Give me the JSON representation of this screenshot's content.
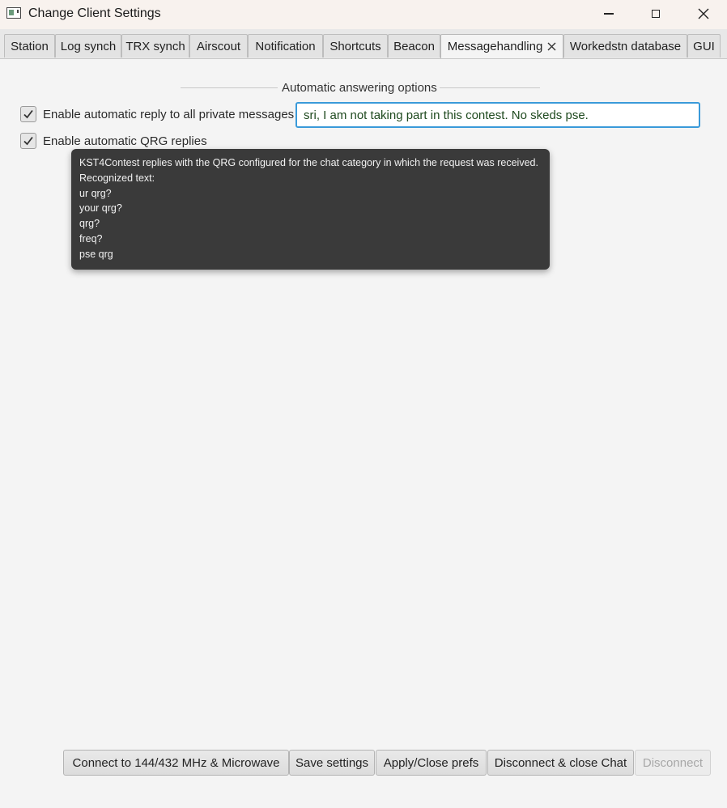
{
  "window": {
    "title": "Change Client Settings"
  },
  "tabs": [
    {
      "label": "Station"
    },
    {
      "label": "Log synch"
    },
    {
      "label": "TRX synch"
    },
    {
      "label": "Airscout"
    },
    {
      "label": "Notification"
    },
    {
      "label": "Shortcuts"
    },
    {
      "label": "Beacon"
    },
    {
      "label": "Messagehandling",
      "active": true
    },
    {
      "label": "Workedstn database"
    },
    {
      "label": "GUI"
    }
  ],
  "section": {
    "title": "Automatic answering options"
  },
  "options": {
    "auto_reply_label": "Enable automatic reply to all private messages",
    "auto_reply_checked": true,
    "auto_reply_text": "sri, I am not taking part in this contest. No skeds pse.",
    "qrg_reply_label": "Enable automatic QRG replies",
    "qrg_reply_checked": true
  },
  "tooltip": {
    "lines": [
      "KST4Contest replies with the QRG configured for the chat category in which the request was received.",
      "Recognized text:",
      "ur qrg?",
      "your qrg?",
      "qrg?",
      "freq?",
      "pse qrg"
    ]
  },
  "buttons": {
    "connect": "Connect to 144/432 MHz & Microwave",
    "save": "Save settings",
    "apply": "Apply/Close prefs",
    "disconnect_close": "Disconnect & close Chat",
    "disconnect": "Disconnect"
  },
  "colors": {
    "focus_border": "#3a9ad9",
    "tooltip_bg": "#3a3a3a"
  }
}
